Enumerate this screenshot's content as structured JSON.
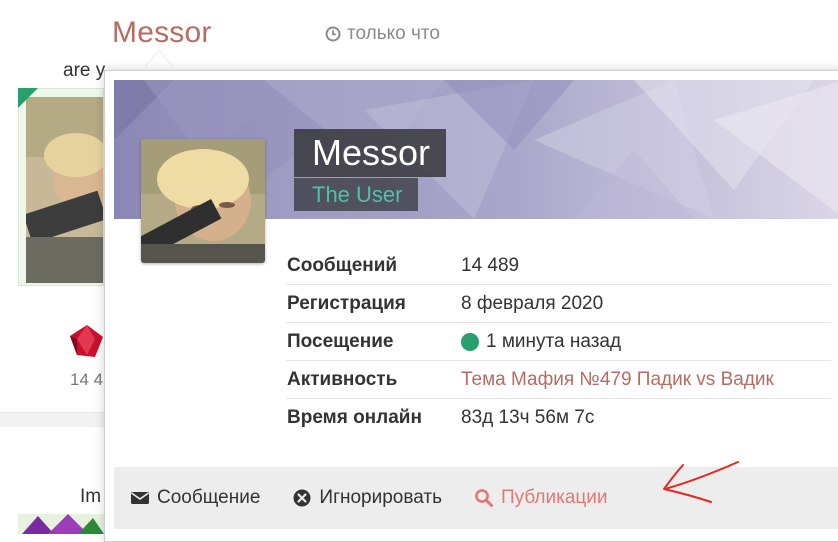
{
  "post": {
    "author": "Messor",
    "time": "только что",
    "text_fragment": "are y",
    "count_fragment": "14 4",
    "next_text_fragment": "Im"
  },
  "profile": {
    "name": "Messor",
    "role": "The User",
    "stats": [
      {
        "label": "Сообщений",
        "value": "14 489"
      },
      {
        "label": "Регистрация",
        "value": "8 февраля 2020"
      },
      {
        "label": "Посещение",
        "value": "1 минута назад"
      },
      {
        "label": "Активность",
        "value": "Тема Мафия №479 Падик vs Вадик"
      },
      {
        "label": "Время онлайн",
        "value": "83д 13ч 56м 7с"
      }
    ],
    "actions": [
      {
        "label": "Сообщение",
        "icon": "envelope-icon"
      },
      {
        "label": "Игнорировать",
        "icon": "ignore-icon"
      },
      {
        "label": "Публикации",
        "icon": "search-icon"
      }
    ]
  },
  "colors": {
    "author_link": "#b86b63",
    "role": "#4cc3a6",
    "online": "#27a06b",
    "accent_action": "#e07a74",
    "annotation_arrow": "#e8261f"
  }
}
